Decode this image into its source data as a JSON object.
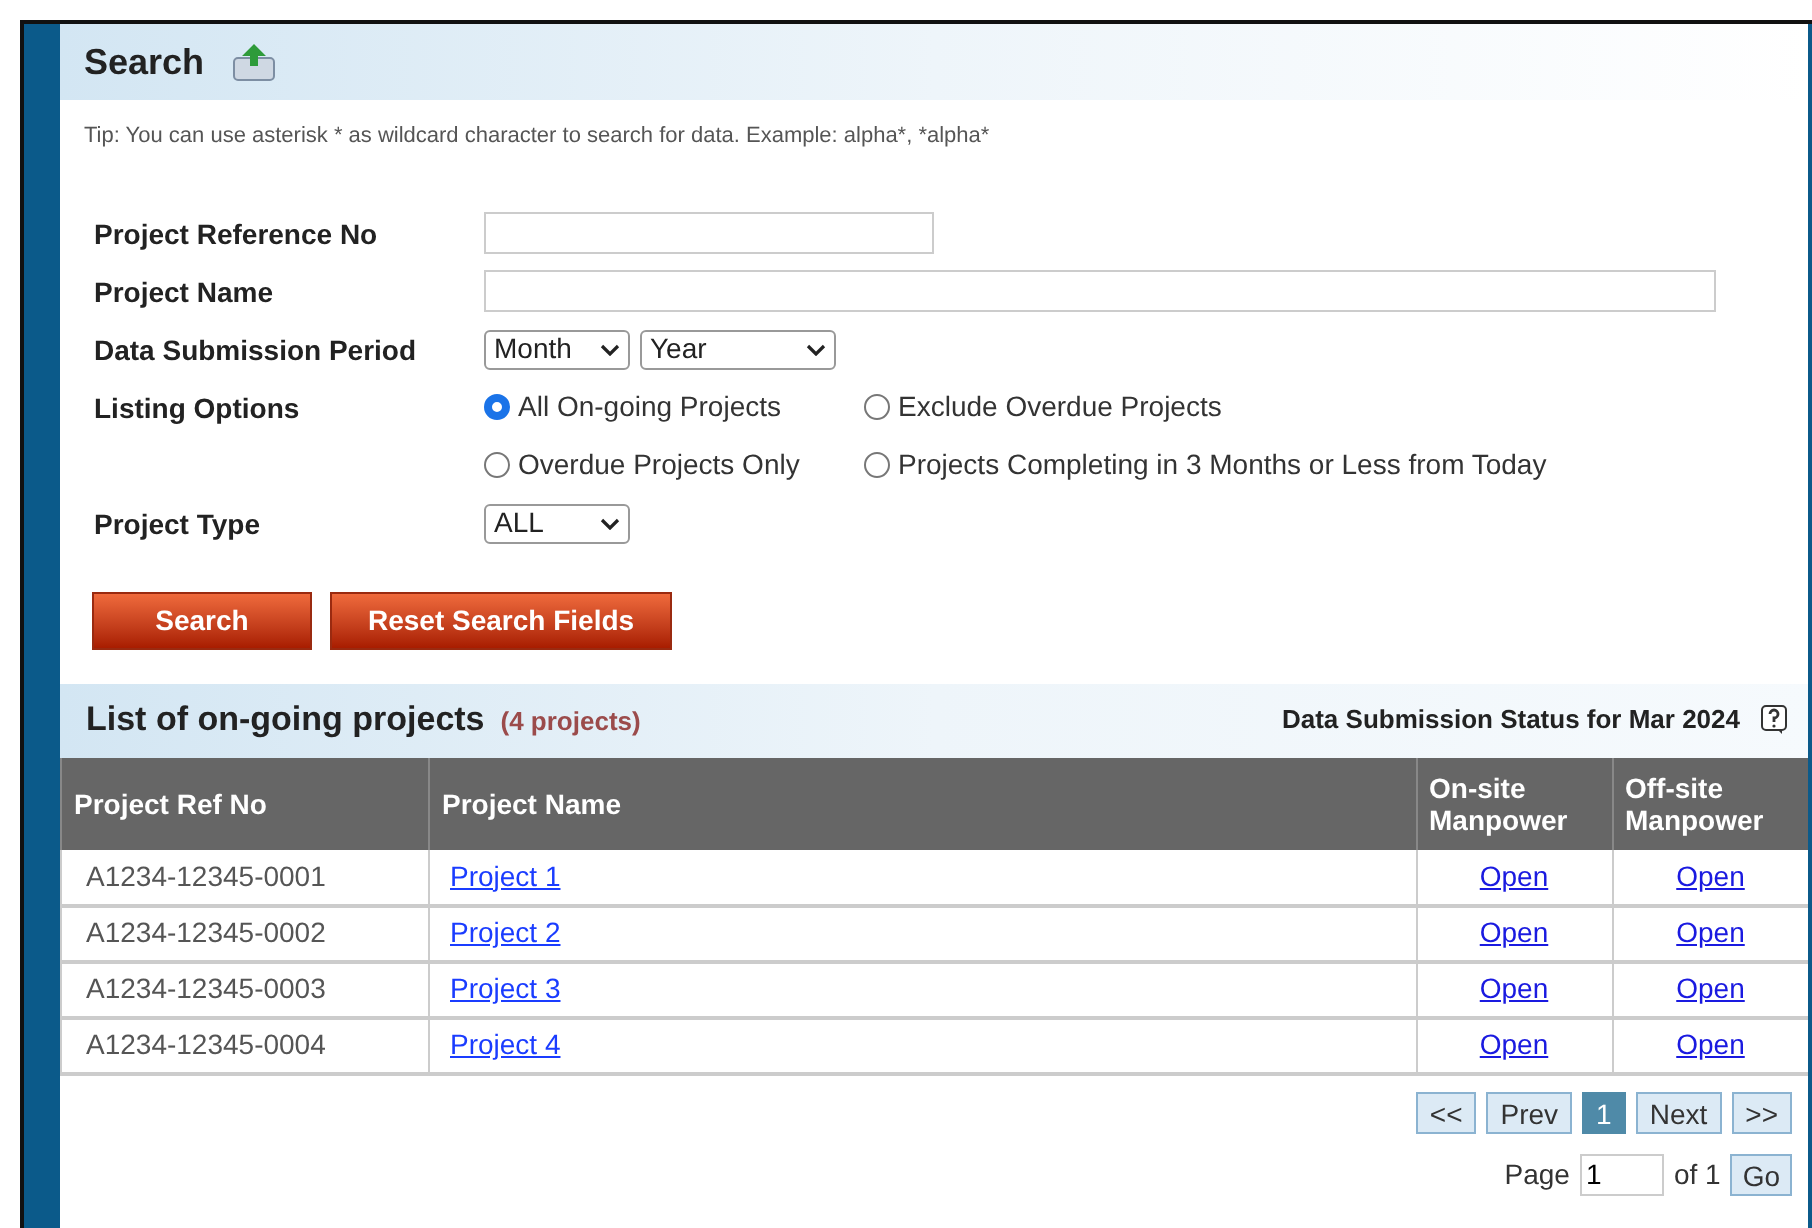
{
  "search": {
    "title": "Search",
    "tip": "Tip: You can use asterisk * as wildcard character to search for data. Example: alpha*, *alpha*",
    "fields": [
      {
        "kind": "text",
        "label": "Project Reference No",
        "wide": false
      },
      {
        "kind": "text",
        "label": "Project Name",
        "wide": true
      },
      {
        "kind": "selects",
        "label": "Data Submission Period",
        "options": [
          "Month",
          "Year"
        ]
      },
      {
        "kind": "radios",
        "label": "Listing Options",
        "options": [
          {
            "label": "All On-going Projects",
            "selected": true
          },
          {
            "label": "Exclude Overdue Projects",
            "selected": false
          },
          {
            "label": "Overdue Projects Only",
            "selected": false
          },
          {
            "label": "Projects Completing in 3 Months or Less from Today",
            "selected": false
          }
        ]
      },
      {
        "kind": "selects",
        "label": "Project Type",
        "options": [
          "ALL"
        ]
      }
    ],
    "buttons": [
      "Search",
      "Reset Search Fields"
    ]
  },
  "list": {
    "title": "List of on-going projects",
    "count": "(4 projects)",
    "status_title": "Data Submission Status for Mar 2024",
    "columns": [
      "Project Ref No",
      "Project Name",
      "On-site Manpower",
      "Off-site Manpower"
    ],
    "rows": [
      {
        "ref": "A1234-12345-0001",
        "name": "Project 1",
        "onsite": "Open",
        "offsite": "Open"
      },
      {
        "ref": "A1234-12345-0002",
        "name": "Project 2",
        "onsite": "Open",
        "offsite": "Open"
      },
      {
        "ref": "A1234-12345-0003",
        "name": "Project 3",
        "onsite": "Open",
        "offsite": "Open"
      },
      {
        "ref": "A1234-12345-0004",
        "name": "Project 4",
        "onsite": "Open",
        "offsite": "Open"
      }
    ],
    "pager": [
      {
        "label": "<<",
        "selected": false
      },
      {
        "label": "Prev",
        "selected": false
      },
      {
        "label": "1",
        "selected": true
      },
      {
        "label": "Next",
        "selected": false
      },
      {
        "label": ">>",
        "selected": false
      }
    ],
    "page_label": "Page",
    "page_value": "1",
    "of_label": "of 1",
    "go": "Go"
  }
}
